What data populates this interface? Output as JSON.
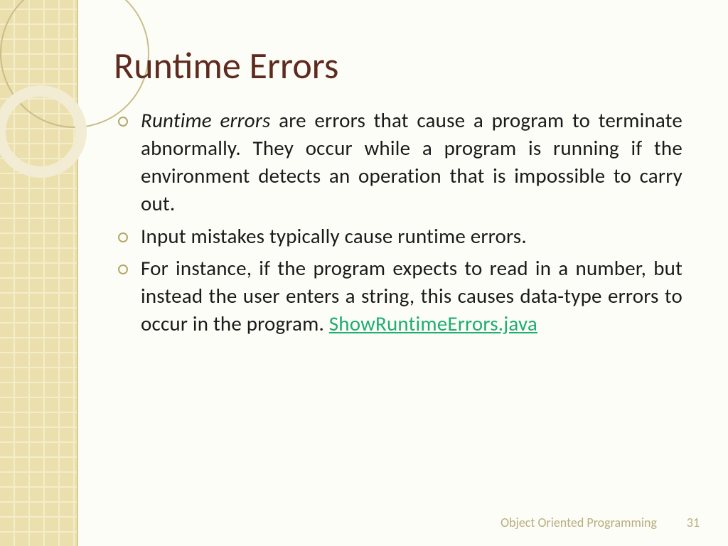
{
  "title": "Runtime Errors",
  "bullets": [
    {
      "lead": "Runtime errors",
      "rest": " are errors that cause a program to terminate abnormally. They occur while a program is running if the environment detects an operation that is impossible to carry out."
    },
    {
      "text": "Input mistakes typically cause runtime errors."
    },
    {
      "text": "For instance, if the program expects to read in a number, but instead the user enters a string, this causes data-type errors to occur in the program. ",
      "link": "ShowRuntimeErrors.java"
    }
  ],
  "footer": "Object Oriented Programming",
  "page": "31"
}
